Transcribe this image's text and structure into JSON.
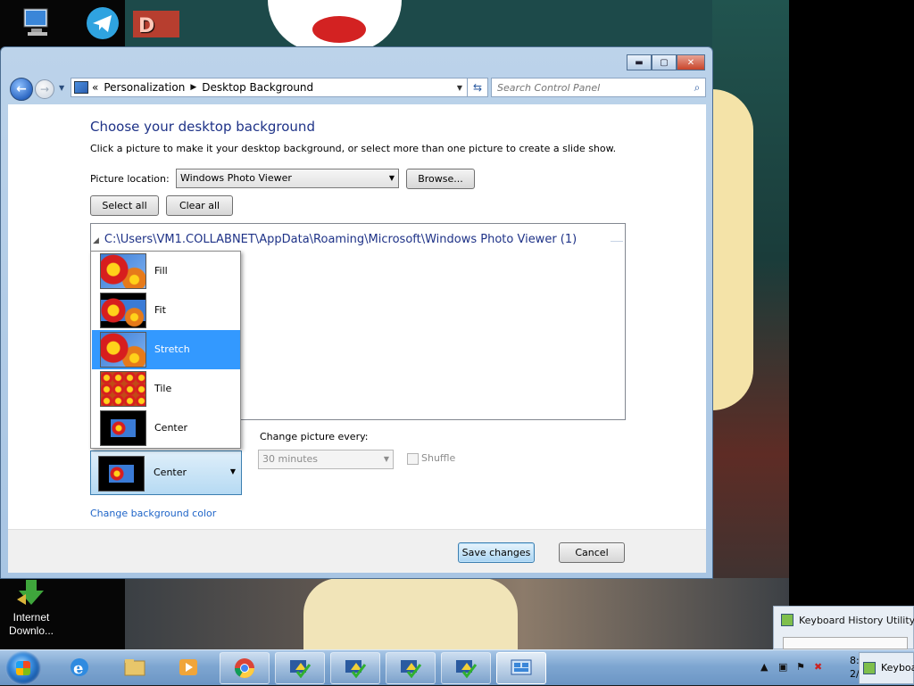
{
  "window": {
    "breadcrumb": [
      "Personalization",
      "Desktop Background"
    ],
    "breadcrumb_prefix": "«",
    "search_placeholder": "Search Control Panel",
    "caption": {
      "minimize": "▬",
      "maximize": "▢",
      "close": "✕"
    }
  },
  "page": {
    "title": "Choose your desktop background",
    "subtitle": "Click a picture to make it your desktop background, or select more than one picture to create a slide show.",
    "picture_location_label": "Picture location:",
    "picture_location_value": "Windows Photo Viewer",
    "browse_label": "Browse...",
    "select_all_label": "Select all",
    "clear_all_label": "Clear all",
    "folder_path": "C:\\Users\\VM1.COLLABNET\\AppData\\Roaming\\Microsoft\\Windows Photo Viewer (1)",
    "picture_position": {
      "selected": "Center",
      "options": [
        "Fill",
        "Fit",
        "Stretch",
        "Tile",
        "Center"
      ],
      "highlighted": "Stretch"
    },
    "change_picture_label": "Change picture every:",
    "change_picture_value": "30 minutes",
    "shuffle_label": "Shuffle",
    "shuffle_checked": false,
    "change_bg_color_link": "Change background color",
    "save_label": "Save changes",
    "cancel_label": "Cancel"
  },
  "desktop": {
    "icons": [
      {
        "label": "Internet\nDownlo..."
      }
    ]
  },
  "popup": {
    "title": "Keyboard History Utility"
  },
  "taskbar": {
    "keyboard_task_label": "Keyboa",
    "clock_line1": "8:",
    "clock_line2": "2/"
  },
  "colors": {
    "selection": "#3399ff",
    "title_blue": "#1e3287",
    "link_blue": "#1e64c8"
  }
}
